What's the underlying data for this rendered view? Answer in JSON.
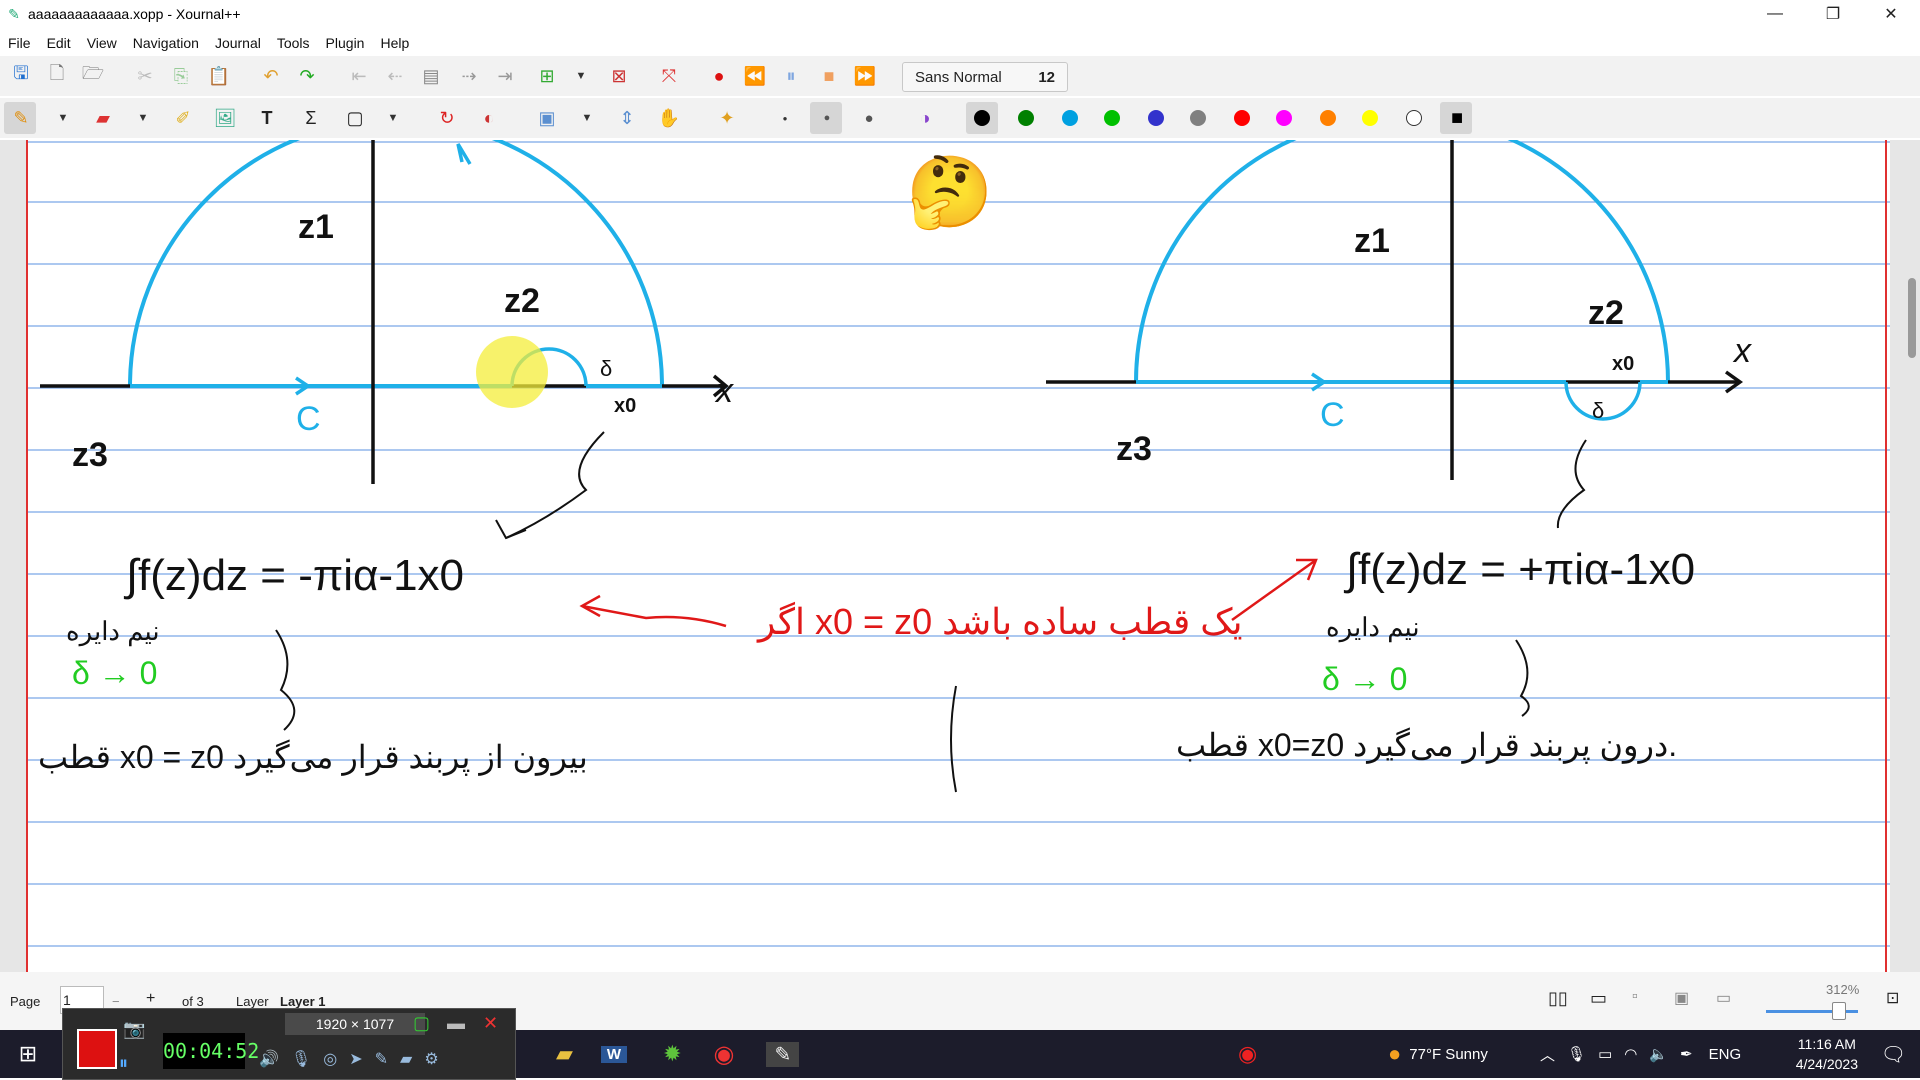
{
  "window": {
    "title": "aaaaaaaaaaaaa.xopp - Xournal++",
    "minimize": "—",
    "maximize": "❐",
    "close": "✕"
  },
  "menu": [
    "File",
    "Edit",
    "View",
    "Navigation",
    "Journal",
    "Tools",
    "Plugin",
    "Help"
  ],
  "toolbar": {
    "font_name": "Sans Normal",
    "font_size": "12"
  },
  "palette": [
    "#000000",
    "#008000",
    "#00a0e0",
    "#00c000",
    "#3333cc",
    "#808080",
    "#ff0000",
    "#ff00ff",
    "#ff8000",
    "#ffff00",
    "#ffffff"
  ],
  "canvas": {
    "left_diagram": {
      "z1": "z1",
      "z2": "z2",
      "z3": "z3",
      "x_axis": "x",
      "contour": "C",
      "x0": "x0",
      "delta": "δ",
      "integral": "∫f(z)dz = -πiα-1x0",
      "half_circle_note": "نیم دایره",
      "limit": "δ → 0",
      "pole_text": "قطب x0 = z0 بیرون از پربند قرار می‌گیرد"
    },
    "right_diagram": {
      "z1": "z1",
      "z2": "z2",
      "z3": "z3",
      "x_axis": "x",
      "contour": "C",
      "x0": "x0",
      "delta": "δ",
      "integral": "∫f(z)dz = +πiα-1x0",
      "half_circle_note": "نیم دایره",
      "limit": "δ → 0",
      "pole_text": "قطب x0=z0 درون پربند قرار می‌گیرد."
    },
    "center_note": "اگر x0 = z0 یک قطب ساده باشد",
    "emoji": "🤔"
  },
  "status": {
    "page_label": "Page",
    "page_value": "1",
    "of_pages": "of 3",
    "layer_label": "Layer",
    "layer_value": "Layer 1",
    "zoom": "312%"
  },
  "recorder": {
    "resolution": "1920 × 1077",
    "timer": "00:04:52"
  },
  "taskbar": {
    "weather": "77°F  Sunny",
    "lang": "ENG",
    "time": "11:16 AM",
    "date": "4/24/2023"
  }
}
